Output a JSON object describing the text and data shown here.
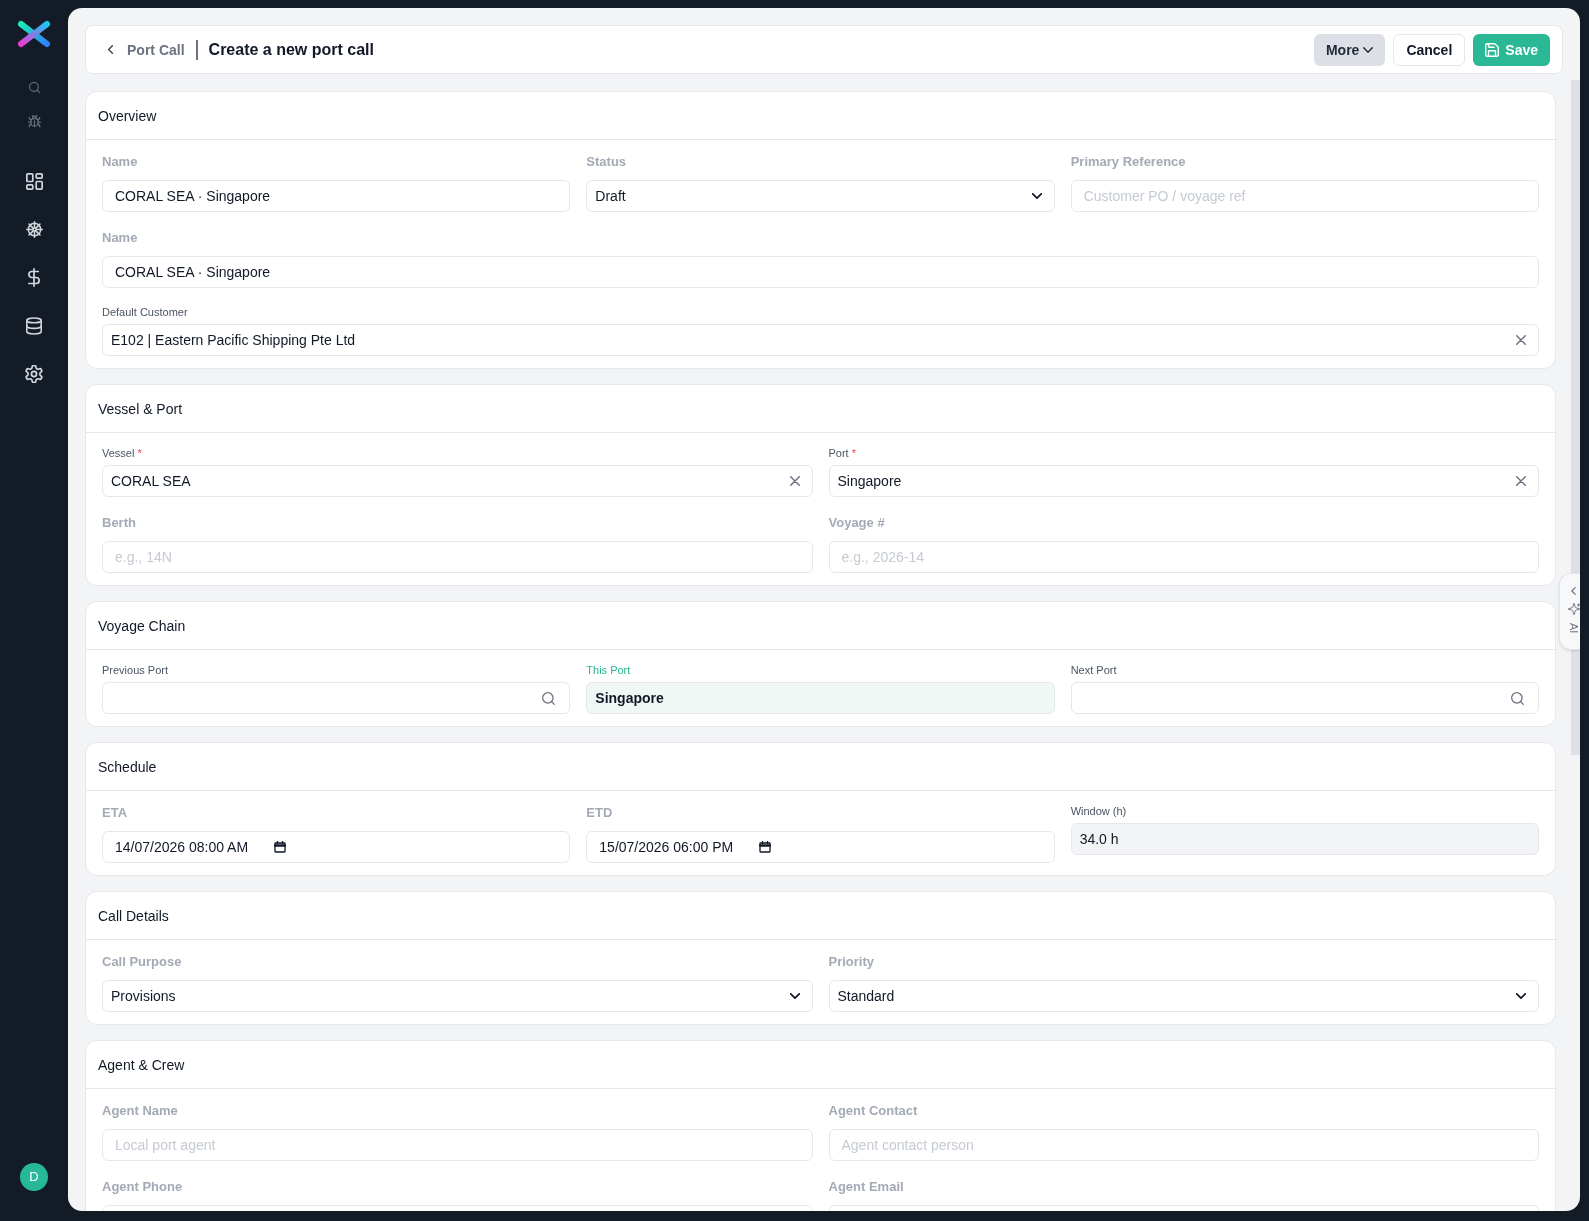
{
  "sidebar": {
    "avatar": "D"
  },
  "header": {
    "back_link": "Port Call",
    "title": "Create a new port call",
    "buttons": [
      {
        "label": "More",
        "kind": "menu"
      },
      {
        "label": "Cancel",
        "kind": "secondary"
      },
      {
        "label": "Save",
        "kind": "primary"
      }
    ]
  },
  "sections": [
    {
      "title": "Overview",
      "rows": [
        {
          "fields": [
            {
              "label": "Name",
              "kind": "text",
              "value": "CORAL SEA · Singapore"
            },
            {
              "label": "Status",
              "kind": "select",
              "value": "Draft"
            },
            {
              "label": "Primary Reference",
              "kind": "text",
              "placeholder": "Customer PO / voyage ref"
            }
          ]
        },
        {
          "fields": [
            {
              "label": "Name",
              "kind": "text",
              "value": "CORAL SEA · Singapore"
            }
          ]
        },
        {
          "fields": [
            {
              "label": "Default Customer",
              "kind": "clearable",
              "value": "E102 | Eastern Pacific Shipping Pte Ltd"
            }
          ]
        }
      ]
    },
    {
      "title": "Vessel & Port",
      "rows": [
        {
          "fields": [
            {
              "label": "Vessel",
              "required_mark": "*",
              "kind": "clearable",
              "value": "CORAL SEA"
            },
            {
              "label": "Port",
              "required_mark": "*",
              "kind": "clearable",
              "value": "Singapore"
            }
          ]
        },
        {
          "fields": [
            {
              "label": "Berth",
              "kind": "text",
              "placeholder": "e.g., 14N"
            },
            {
              "label": "Voyage #",
              "kind": "text",
              "placeholder": "e.g., 2026-14"
            }
          ]
        }
      ]
    },
    {
      "title": "Voyage Chain",
      "rows": [
        {
          "fields": [
            {
              "label": "Previous Port",
              "kind": "search"
            },
            {
              "label": "This Port",
              "kind": "highlight",
              "value": "Singapore"
            },
            {
              "label": "Next Port",
              "kind": "search"
            }
          ]
        }
      ]
    },
    {
      "title": "Schedule",
      "rows": [
        {
          "fields": [
            {
              "label": "ETA",
              "kind": "datetime",
              "value": "14/07/2026 08:00 AM"
            },
            {
              "label": "ETD",
              "kind": "datetime",
              "value": "15/07/2026 06:00 PM"
            },
            {
              "label": "Window (h)",
              "kind": "readonly",
              "value": "34.0 h"
            }
          ]
        }
      ]
    },
    {
      "title": "Call Details",
      "rows": [
        {
          "fields": [
            {
              "label": "Call Purpose",
              "kind": "select",
              "value": "Provisions"
            },
            {
              "label": "Priority",
              "kind": "select",
              "value": "Standard"
            }
          ]
        }
      ]
    },
    {
      "title": "Agent & Crew",
      "rows": [
        {
          "fields": [
            {
              "label": "Agent Name",
              "kind": "text",
              "placeholder": "Local port agent"
            },
            {
              "label": "Agent Contact",
              "kind": "text",
              "placeholder": "Agent contact person"
            }
          ]
        },
        {
          "fields": [
            {
              "label": "Agent Phone",
              "kind": "text"
            },
            {
              "label": "Agent Email",
              "kind": "text"
            }
          ]
        }
      ]
    }
  ],
  "ai_tab": {
    "label": "AI"
  }
}
